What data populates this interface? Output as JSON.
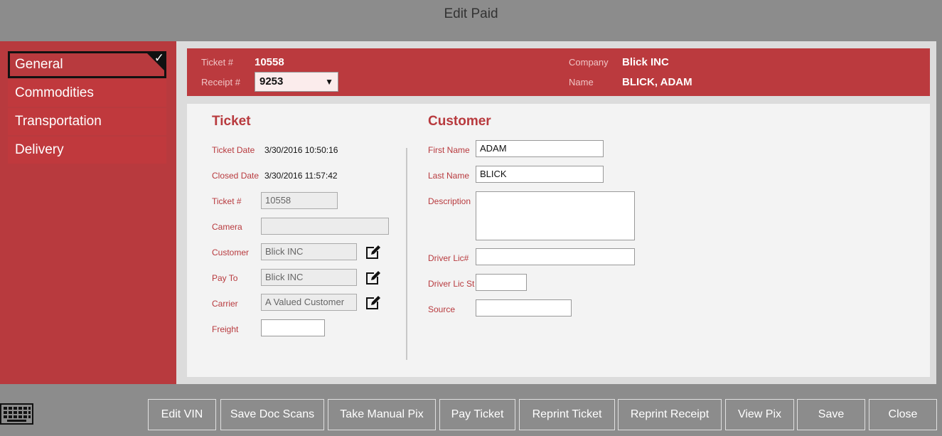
{
  "window": {
    "title": "Edit Paid"
  },
  "sidebar": {
    "items": [
      {
        "label": "General",
        "active": true
      },
      {
        "label": "Commodities"
      },
      {
        "label": "Transportation"
      },
      {
        "label": "Delivery"
      }
    ]
  },
  "header": {
    "ticket_label": "Ticket #",
    "ticket_value": "10558",
    "receipt_label": "Receipt #",
    "receipt_value": "9253",
    "company_label": "Company",
    "company_value": "Blick INC",
    "name_label": "Name",
    "name_value": "BLICK, ADAM"
  },
  "ticket": {
    "title": "Ticket",
    "ticket_date_label": "Ticket Date",
    "ticket_date_value": "3/30/2016 10:50:16",
    "closed_date_label": "Closed Date",
    "closed_date_value": "3/30/2016 11:57:42",
    "ticket_no_label": "Ticket #",
    "ticket_no_value": "10558",
    "camera_label": "Camera",
    "camera_value": "",
    "customer_label": "Customer",
    "customer_value": "Blick INC",
    "payto_label": "Pay To",
    "payto_value": "Blick INC",
    "carrier_label": "Carrier",
    "carrier_value": "A Valued Customer",
    "freight_label": "Freight",
    "freight_value": ""
  },
  "customer": {
    "title": "Customer",
    "first_name_label": "First Name",
    "first_name_value": "ADAM",
    "last_name_label": "Last Name",
    "last_name_value": "BLICK",
    "description_label": "Description",
    "description_value": "",
    "driver_lic_label": "Driver Lic#",
    "driver_lic_value": "",
    "driver_lic_st_label": "Driver Lic St",
    "driver_lic_st_value": "",
    "source_label": "Source",
    "source_value": ""
  },
  "toolbar": {
    "edit_vin": "Edit VIN",
    "save_doc_scans": "Save Doc Scans",
    "take_manual_pix": "Take Manual Pix",
    "pay_ticket": "Pay Ticket",
    "reprint_ticket": "Reprint Ticket",
    "reprint_receipt": "Reprint Receipt",
    "view_pix": "View Pix",
    "save": "Save",
    "close": "Close"
  },
  "icons": {
    "edit": "edit-icon",
    "keyboard": "keyboard-icon",
    "check": "checkmark-icon",
    "chevron": "chevron-down-icon"
  },
  "colors": {
    "accent": "#b83a3e",
    "background": "#8c8c8c",
    "panel": "#f3f3f3"
  }
}
